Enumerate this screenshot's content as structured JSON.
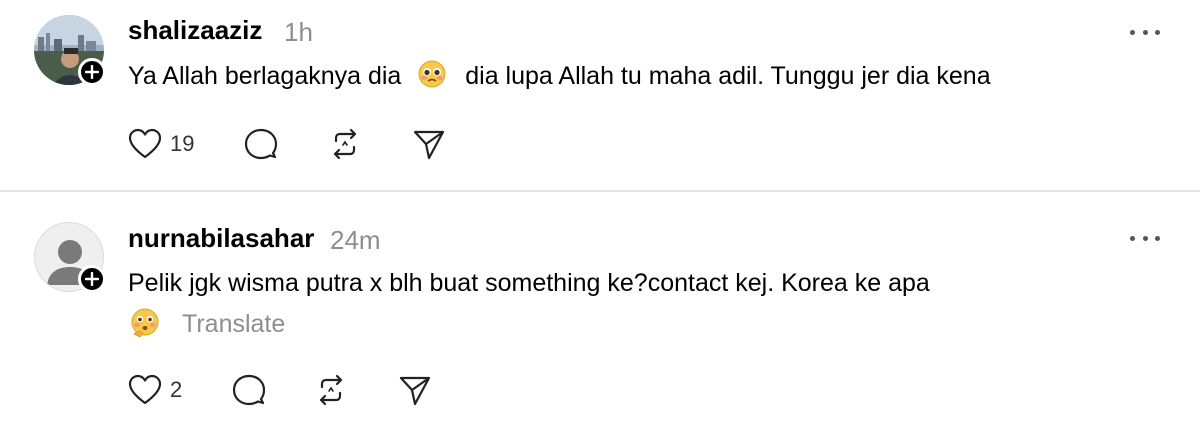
{
  "posts": [
    {
      "username": "shalizaaziz",
      "time": "1h",
      "text_before_emoji": "Ya Allah berlagaknya dia",
      "text_after_emoji": "dia lupa Allah tu maha adil. Tunggu jer dia kena",
      "emoji": "pleading-face-emoji",
      "likes": "19",
      "avatar": "photo-avatar"
    },
    {
      "username": "nurnabilasahar",
      "time": "24m",
      "text": "Pelik jgk wisma putra x blh buat something ke?contact kej. Korea ke apa",
      "emoji": "thinking-flushed-face-emoji",
      "translate_label": "Translate",
      "likes": "2",
      "avatar": "default-avatar"
    }
  ],
  "icons": {
    "like": "heart-icon",
    "reply": "comment-icon",
    "repost": "repost-icon",
    "share": "send-icon",
    "more": "more-icon",
    "follow": "plus-icon"
  },
  "colors": {
    "muted": "#8e8e8e",
    "divider": "#e3e3e3",
    "text": "#000000"
  }
}
